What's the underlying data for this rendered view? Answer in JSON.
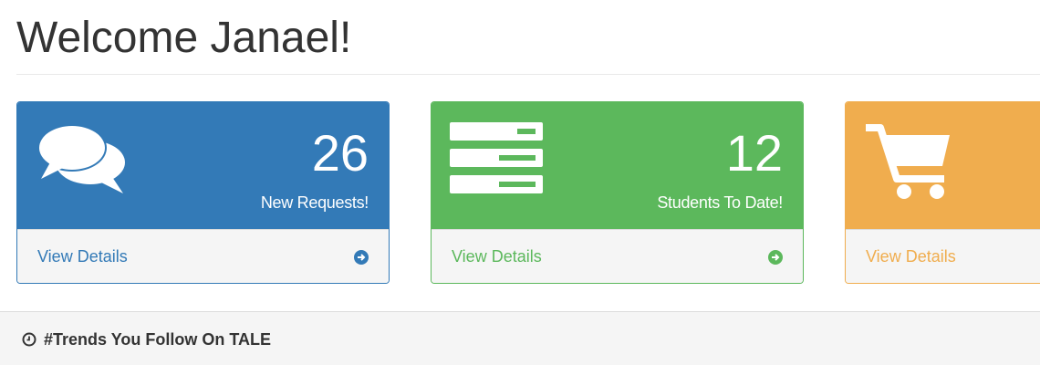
{
  "header": {
    "title": "Welcome Janael!"
  },
  "panels": [
    {
      "color": "#337ab7",
      "icon": "comments-icon",
      "count": "26",
      "caption": "New Requests!",
      "footer_label": "View Details",
      "footer_icon": "arrow-circle-right-icon"
    },
    {
      "color": "#5cb85c",
      "icon": "server-icon",
      "count": "12",
      "caption": "Students To Date!",
      "footer_label": "View Details",
      "footer_icon": "arrow-circle-right-icon"
    },
    {
      "color": "#f0ad4e",
      "icon": "shopping-cart-icon",
      "count": "",
      "caption": "",
      "footer_label": "View Details",
      "footer_icon": "arrow-circle-right-icon"
    }
  ],
  "trends": {
    "icon": "clock-icon",
    "title": "#Trends You Follow On TALE"
  }
}
